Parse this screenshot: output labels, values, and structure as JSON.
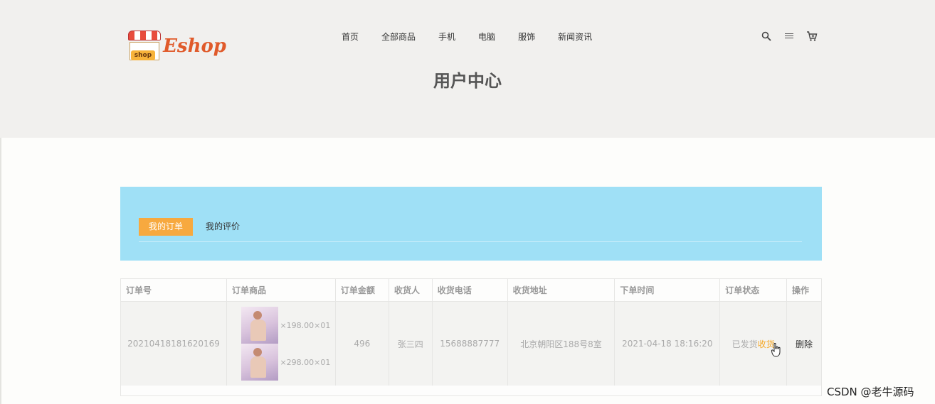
{
  "logo": {
    "tag": "shop",
    "text": "Eshop"
  },
  "nav": {
    "items": [
      "首页",
      "全部商品",
      "手机",
      "电脑",
      "服饰",
      "新闻资讯"
    ]
  },
  "header_icons": [
    "search-icon",
    "menu-icon",
    "cart-icon"
  ],
  "page_title": "用户中心",
  "tabs": {
    "active": "我的订单",
    "other": "我的评价"
  },
  "table": {
    "headers": [
      "订单号",
      "订单商品",
      "订单金额",
      "收货人",
      "收货电话",
      "收货地址",
      "下单时间",
      "订单状态",
      "操作"
    ],
    "rows": [
      {
        "order_no": "20210418181620169",
        "products": [
          {
            "price_qty": "×198.00×01"
          },
          {
            "price_qty": "×298.00×01"
          }
        ],
        "amount": "496",
        "receiver": "张三四",
        "phone": "15688887777",
        "address": "北京朝阳区188号8室",
        "time": "2021-04-18 18:16:20",
        "status": "已发货",
        "status_action": "收货",
        "operation": "删除"
      }
    ]
  },
  "watermark": "CSDN @老牛源码",
  "colors": {
    "accent": "#f7a93f",
    "panel": "#9fe0f6",
    "header_bg": "#f1f0ee"
  }
}
